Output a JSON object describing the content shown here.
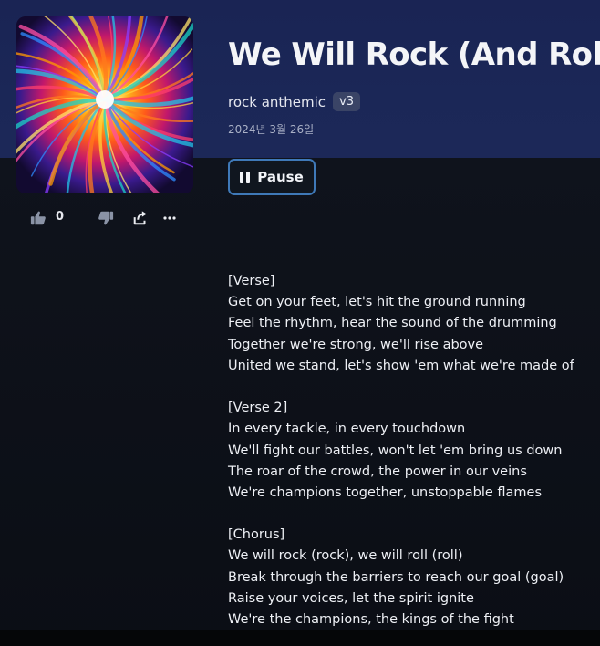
{
  "song": {
    "title": "We Will Rock (And Roll)",
    "style": "rock anthemic",
    "version": "v3",
    "date": "2024년 3월 26일"
  },
  "actions": {
    "like_icon": "thumbs-up-icon",
    "like_count": "0",
    "dislike_icon": "thumbs-down-icon",
    "share_icon": "share-icon",
    "more_icon": "more-icon"
  },
  "player": {
    "pause_label": "Pause",
    "pause_icon": "pause-icon"
  },
  "lyrics": [
    "[Verse]",
    "Get on your feet, let's hit the ground running",
    "Feel the rhythm, hear the sound of the drumming",
    "Together we're strong, we'll rise above",
    "United we stand, let's show 'em what we're made of",
    "",
    "[Verse 2]",
    "In every tackle, in every touchdown",
    "We'll fight our battles, won't let 'em bring us down",
    "The roar of the crowd, the power in our veins",
    "We're champions together, unstoppable flames",
    "",
    "[Chorus]",
    "We will rock (rock), we will roll (roll)",
    "Break through the barriers to reach our goal (goal)",
    "Raise your voices, let the spirit ignite",
    "We're the champions, the kings of the fight"
  ],
  "colors": {
    "header_bg": "#1b2757",
    "body_bg": "#0b0e15",
    "button_border": "#3f79b8",
    "badge_bg": "#3a4466"
  }
}
